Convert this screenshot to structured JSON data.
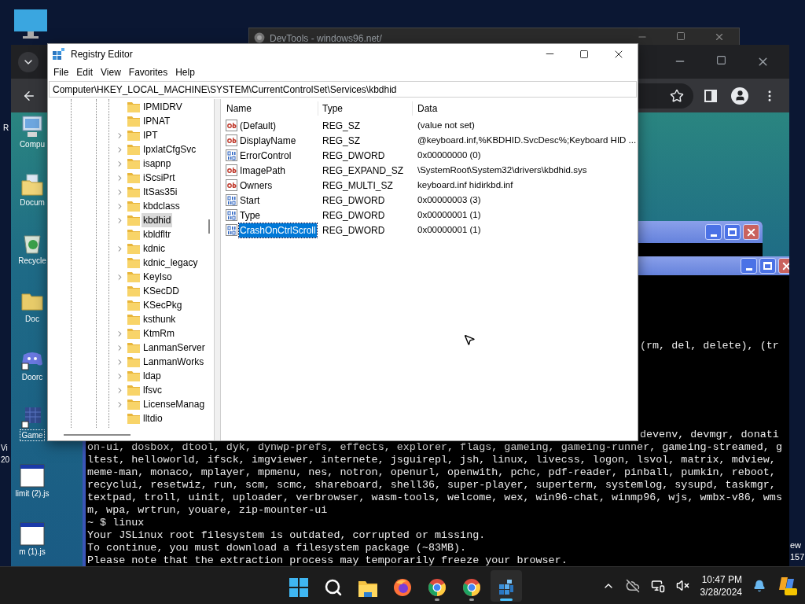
{
  "desktop": {
    "left_edge_texts": [
      "R",
      "Vi",
      "20"
    ],
    "right_edge_texts": [
      "ew",
      "157"
    ]
  },
  "devtools_window": {
    "title": "DevTools - windows96.net/"
  },
  "web_desktop": {
    "icons": [
      {
        "label": "Compu",
        "kind": "computer",
        "selected": false
      },
      {
        "label": "Docum",
        "kind": "documents",
        "selected": false
      },
      {
        "label": "Recycle",
        "kind": "recycle",
        "selected": false
      },
      {
        "label": "Doc",
        "kind": "folder",
        "selected": false
      },
      {
        "label": "Doorc",
        "kind": "doorc",
        "selected": false
      },
      {
        "label": "Game",
        "kind": "game",
        "selected": true
      },
      {
        "label": "limit (2).js",
        "kind": "file",
        "selected": false
      },
      {
        "label": "m (1).js",
        "kind": "file",
        "selected": false
      }
    ]
  },
  "terminal": {
    "upper_fragment": "(rm, del, delete), (tr",
    "lines": [
      {
        "text": "devenv, devmgr, donati",
        "kind": "fragment"
      },
      {
        "text": "on-ui, dosbox, dtool, dyk, dynwp-prefs, effects, explorer, flags, gameing, gameing-runner, gameing-streamed, g",
        "kind": "line"
      },
      {
        "text": "ltest, helloworld, ifsck, imgviewer, internete, jsguirepl, jsh, linux, livecss, logon, lsvol, matrix, mdview,",
        "kind": "line"
      },
      {
        "text": "meme-man, monaco, mplayer, mpmenu, nes, notron, openurl, openwith, pchc, pdf-reader, pinball, pumkin, reboot,",
        "kind": "line"
      },
      {
        "text": "recyclui, resetwiz, run, scm, scmc, shareboard, shell36, super-player, superterm, systemlog, sysupd, taskmgr,",
        "kind": "line"
      },
      {
        "text": "textpad, troll, uinit, uploader, verbrowser, wasm-tools, welcome, wex, win96-chat, winmp96, wjs, wmbx-v86, wms",
        "kind": "line"
      },
      {
        "text": "m, wpa, wrtrun, youare, zip-mounter-ui",
        "kind": "line"
      },
      {
        "text": "~ $ linux",
        "kind": "line"
      },
      {
        "text": "Your JSLinux root filesystem is outdated, corrupted or missing.",
        "kind": "line"
      },
      {
        "text": "To continue, you must download a filesystem package (~83MB).",
        "kind": "line"
      },
      {
        "text": "Please note that the extraction process may temporarily freeze your browser.",
        "kind": "line"
      }
    ]
  },
  "registry_editor": {
    "title": "Registry Editor",
    "menu": [
      "File",
      "Edit",
      "View",
      "Favorites",
      "Help"
    ],
    "address": "Computer\\HKEY_LOCAL_MACHINE\\SYSTEM\\CurrentControlSet\\Services\\kbdhid",
    "tree": [
      {
        "label": "IPMIDRV",
        "expandable": false,
        "selected": false
      },
      {
        "label": "IPNAT",
        "expandable": false,
        "selected": false
      },
      {
        "label": "IPT",
        "expandable": true,
        "selected": false
      },
      {
        "label": "IpxlatCfgSvc",
        "expandable": true,
        "selected": false
      },
      {
        "label": "isapnp",
        "expandable": true,
        "selected": false
      },
      {
        "label": "iScsiPrt",
        "expandable": true,
        "selected": false
      },
      {
        "label": "ItSas35i",
        "expandable": true,
        "selected": false
      },
      {
        "label": "kbdclass",
        "expandable": true,
        "selected": false
      },
      {
        "label": "kbdhid",
        "expandable": true,
        "selected": true
      },
      {
        "label": "kbldfltr",
        "expandable": false,
        "selected": false
      },
      {
        "label": "kdnic",
        "expandable": true,
        "selected": false
      },
      {
        "label": "kdnic_legacy",
        "expandable": false,
        "selected": false
      },
      {
        "label": "KeyIso",
        "expandable": true,
        "selected": false
      },
      {
        "label": "KSecDD",
        "expandable": false,
        "selected": false
      },
      {
        "label": "KSecPkg",
        "expandable": false,
        "selected": false
      },
      {
        "label": "ksthunk",
        "expandable": false,
        "selected": false
      },
      {
        "label": "KtmRm",
        "expandable": true,
        "selected": false
      },
      {
        "label": "LanmanServer",
        "expandable": true,
        "selected": false
      },
      {
        "label": "LanmanWorks",
        "expandable": true,
        "selected": false
      },
      {
        "label": "ldap",
        "expandable": true,
        "selected": false
      },
      {
        "label": "lfsvc",
        "expandable": true,
        "selected": false
      },
      {
        "label": "LicenseManag",
        "expandable": true,
        "selected": false
      },
      {
        "label": "lltdio",
        "expandable": false,
        "selected": false
      }
    ],
    "columns": [
      "Name",
      "Type",
      "Data"
    ],
    "values": [
      {
        "name": "(Default)",
        "type": "REG_SZ",
        "data": "(value not set)",
        "kind": "string",
        "selected": false
      },
      {
        "name": "DisplayName",
        "type": "REG_SZ",
        "data": "@keyboard.inf,%KBDHID.SvcDesc%;Keyboard HID ...",
        "kind": "string",
        "selected": false
      },
      {
        "name": "ErrorControl",
        "type": "REG_DWORD",
        "data": "0x00000000 (0)",
        "kind": "number",
        "selected": false
      },
      {
        "name": "ImagePath",
        "type": "REG_EXPAND_SZ",
        "data": "\\SystemRoot\\System32\\drivers\\kbdhid.sys",
        "kind": "string",
        "selected": false
      },
      {
        "name": "Owners",
        "type": "REG_MULTI_SZ",
        "data": "keyboard.inf hidirkbd.inf",
        "kind": "string",
        "selected": false
      },
      {
        "name": "Start",
        "type": "REG_DWORD",
        "data": "0x00000003 (3)",
        "kind": "number",
        "selected": false
      },
      {
        "name": "Type",
        "type": "REG_DWORD",
        "data": "0x00000001 (1)",
        "kind": "number",
        "selected": false
      },
      {
        "name": "CrashOnCtrlScroll",
        "type": "REG_DWORD",
        "data": "0x00000001 (1)",
        "kind": "number",
        "selected": true
      }
    ]
  },
  "taskbar": {
    "apps": [
      {
        "kind": "start",
        "running": false,
        "active": false
      },
      {
        "kind": "search",
        "running": false,
        "active": false
      },
      {
        "kind": "explorer",
        "running": false,
        "active": false
      },
      {
        "kind": "firefox",
        "running": false,
        "active": false
      },
      {
        "kind": "chrome",
        "running": true,
        "active": false
      },
      {
        "kind": "chrome",
        "running": true,
        "active": false
      },
      {
        "kind": "regedit",
        "running": true,
        "active": true
      }
    ],
    "time": "10:47 PM",
    "date": "3/28/2024"
  }
}
